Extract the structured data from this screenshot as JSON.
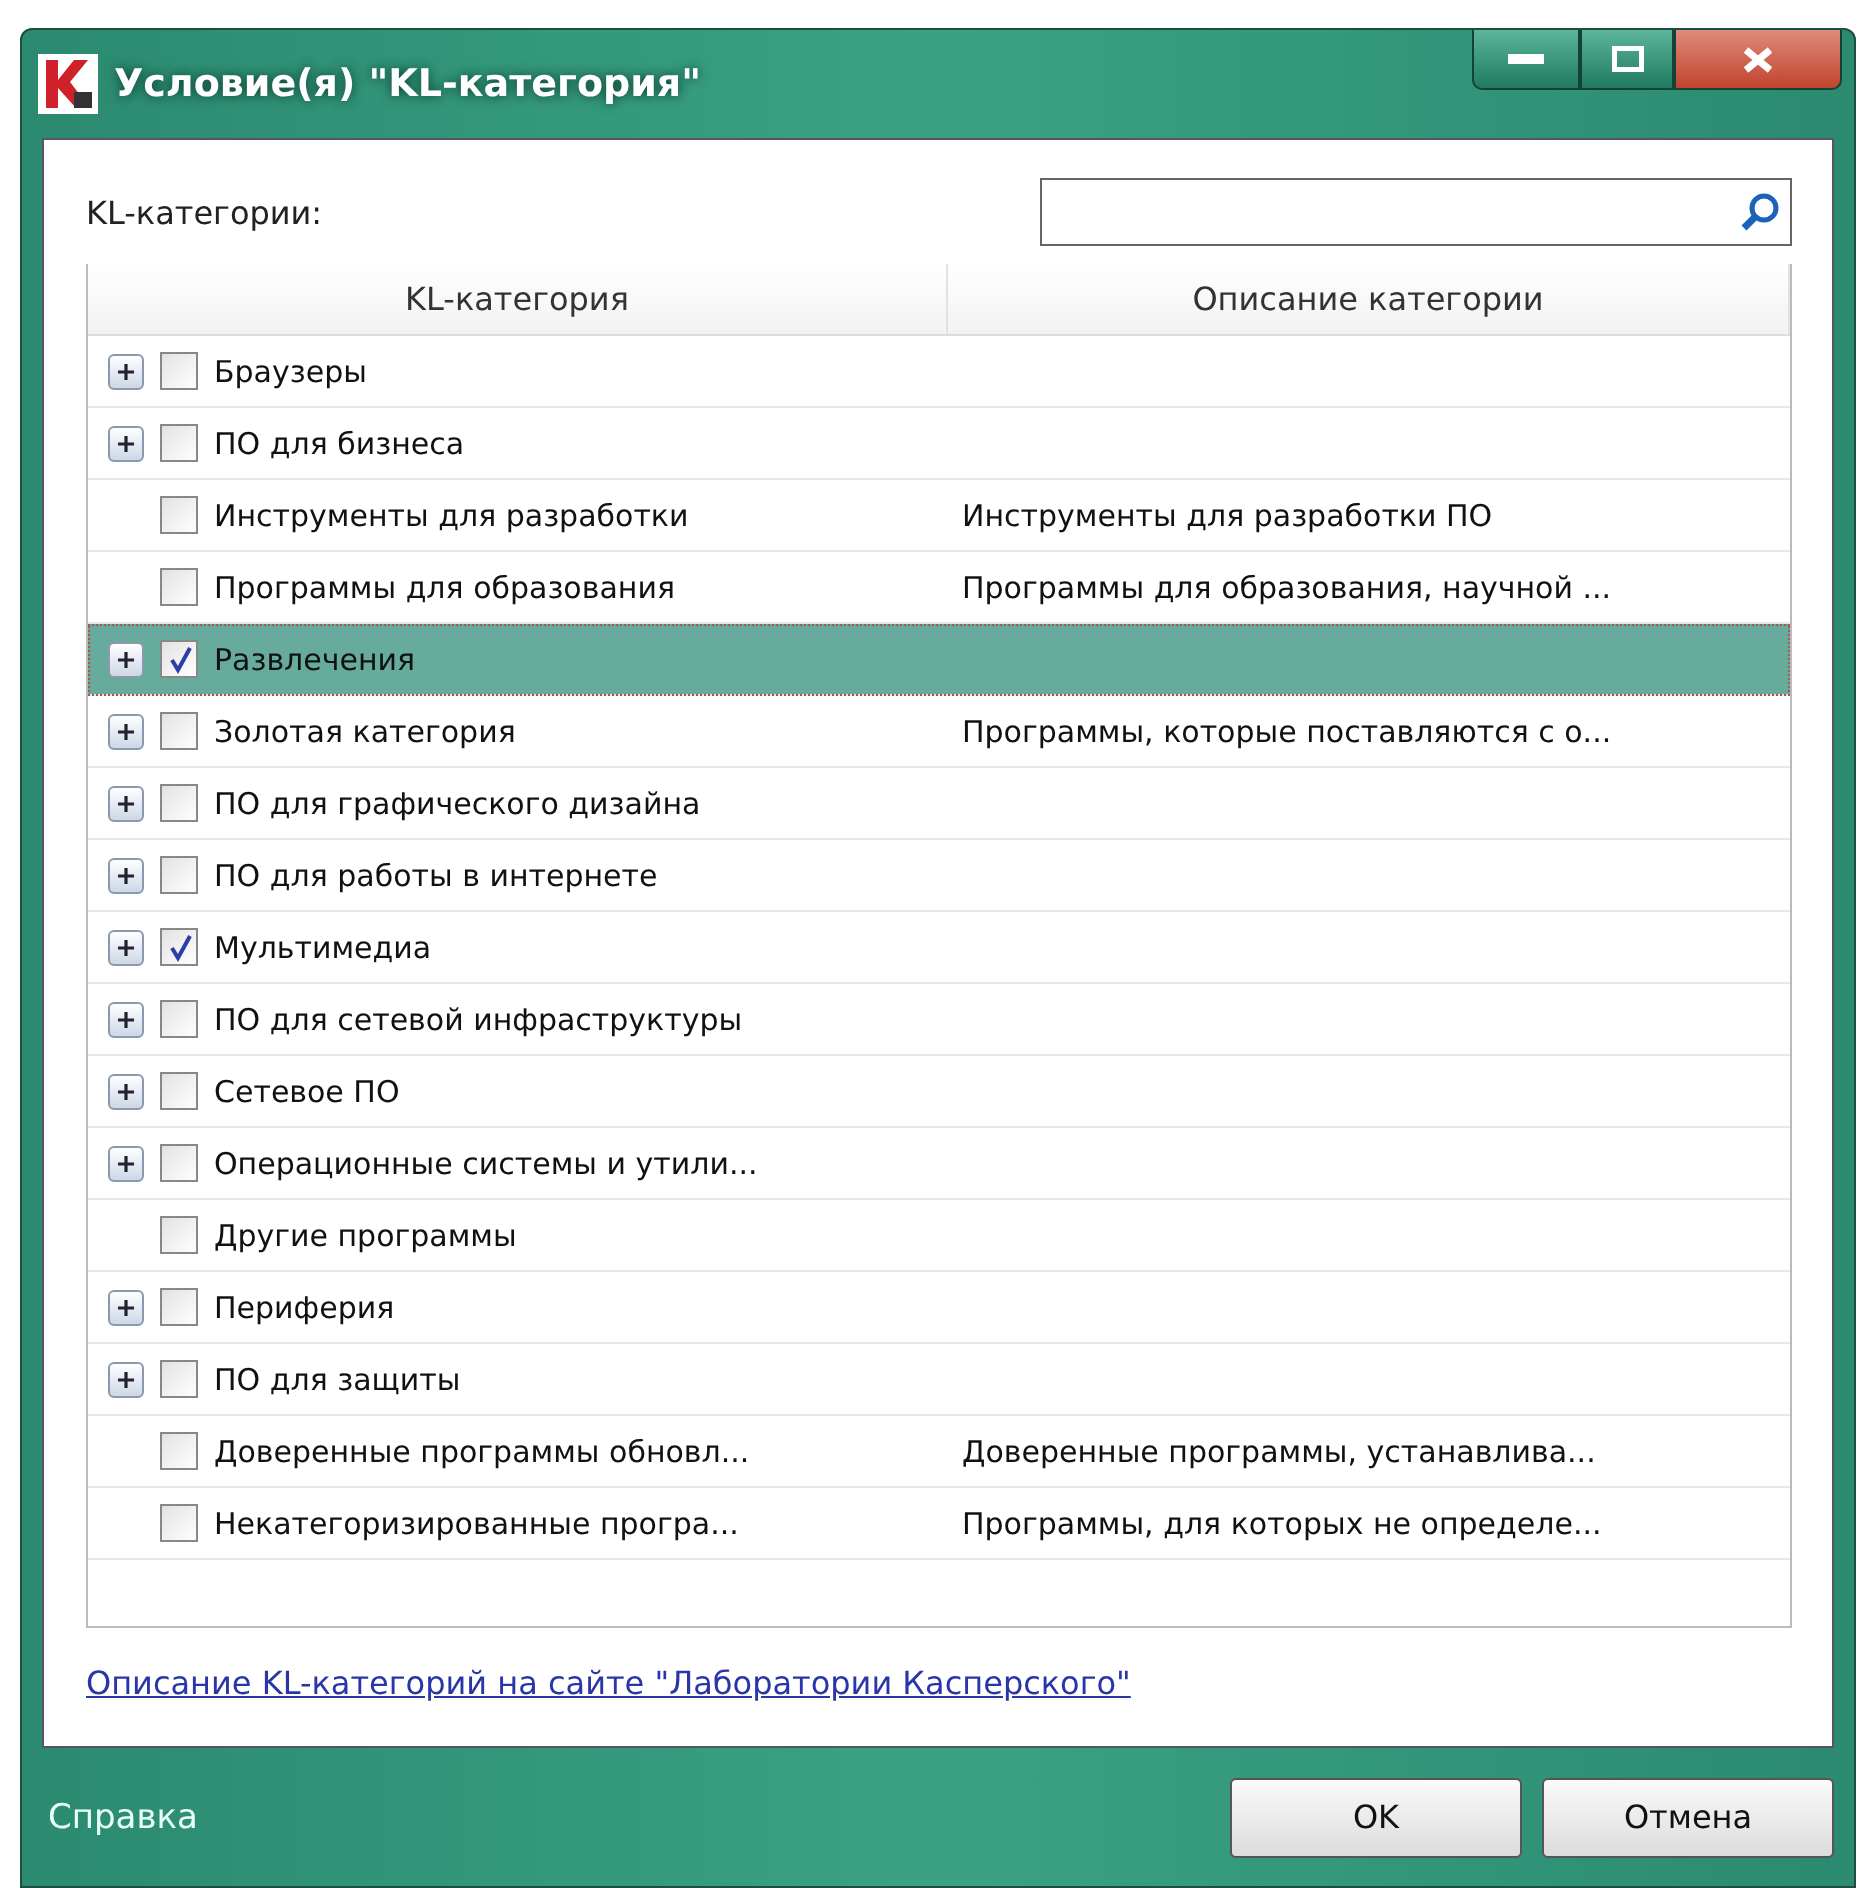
{
  "window": {
    "title": "Условие(я) \"KL-категория\""
  },
  "filter": {
    "label": "KL-категории:"
  },
  "table": {
    "columns": [
      "KL-категория",
      "Описание категории"
    ],
    "rows": [
      {
        "name": "Браузеры",
        "description": "",
        "expandable": true,
        "checked": false,
        "selected": false
      },
      {
        "name": "ПО для бизнеса",
        "description": "",
        "expandable": true,
        "checked": false,
        "selected": false
      },
      {
        "name": "Инструменты для разработки",
        "description": "Инструменты для разработки ПО",
        "expandable": false,
        "checked": false,
        "selected": false
      },
      {
        "name": "Программы для образования",
        "description": "Программы для образования, научной ...",
        "expandable": false,
        "checked": false,
        "selected": false
      },
      {
        "name": "Развлечения",
        "description": "",
        "expandable": true,
        "checked": true,
        "selected": true
      },
      {
        "name": "Золотая категория",
        "description": "Программы, которые поставляются с о...",
        "expandable": true,
        "checked": false,
        "selected": false
      },
      {
        "name": "ПО для графического дизайна",
        "description": "",
        "expandable": true,
        "checked": false,
        "selected": false
      },
      {
        "name": "ПО для работы в интернете",
        "description": "",
        "expandable": true,
        "checked": false,
        "selected": false
      },
      {
        "name": "Мультимедиа",
        "description": "",
        "expandable": true,
        "checked": true,
        "selected": false
      },
      {
        "name": "ПО для сетевой инфраструктуры",
        "description": "",
        "expandable": true,
        "checked": false,
        "selected": false
      },
      {
        "name": "Сетевое ПО",
        "description": "",
        "expandable": true,
        "checked": false,
        "selected": false
      },
      {
        "name": "Операционные системы и утили...",
        "description": "",
        "expandable": true,
        "checked": false,
        "selected": false
      },
      {
        "name": "Другие программы",
        "description": "",
        "expandable": false,
        "checked": false,
        "selected": false
      },
      {
        "name": "Периферия",
        "description": "",
        "expandable": true,
        "checked": false,
        "selected": false
      },
      {
        "name": "ПО для защиты",
        "description": "",
        "expandable": true,
        "checked": false,
        "selected": false
      },
      {
        "name": "Доверенные программы обновл...",
        "description": "Доверенные программы, устанавлива...",
        "expandable": false,
        "checked": false,
        "selected": false
      },
      {
        "name": "Некатегоризированные програ...",
        "description": "Программы, для которых не определе...",
        "expandable": false,
        "checked": false,
        "selected": false
      }
    ]
  },
  "link": "Описание KL-категорий на сайте \"Лаборатории Касперского\"",
  "footer": {
    "help": "Справка",
    "buttons": [
      "OK",
      "Отмена"
    ]
  }
}
